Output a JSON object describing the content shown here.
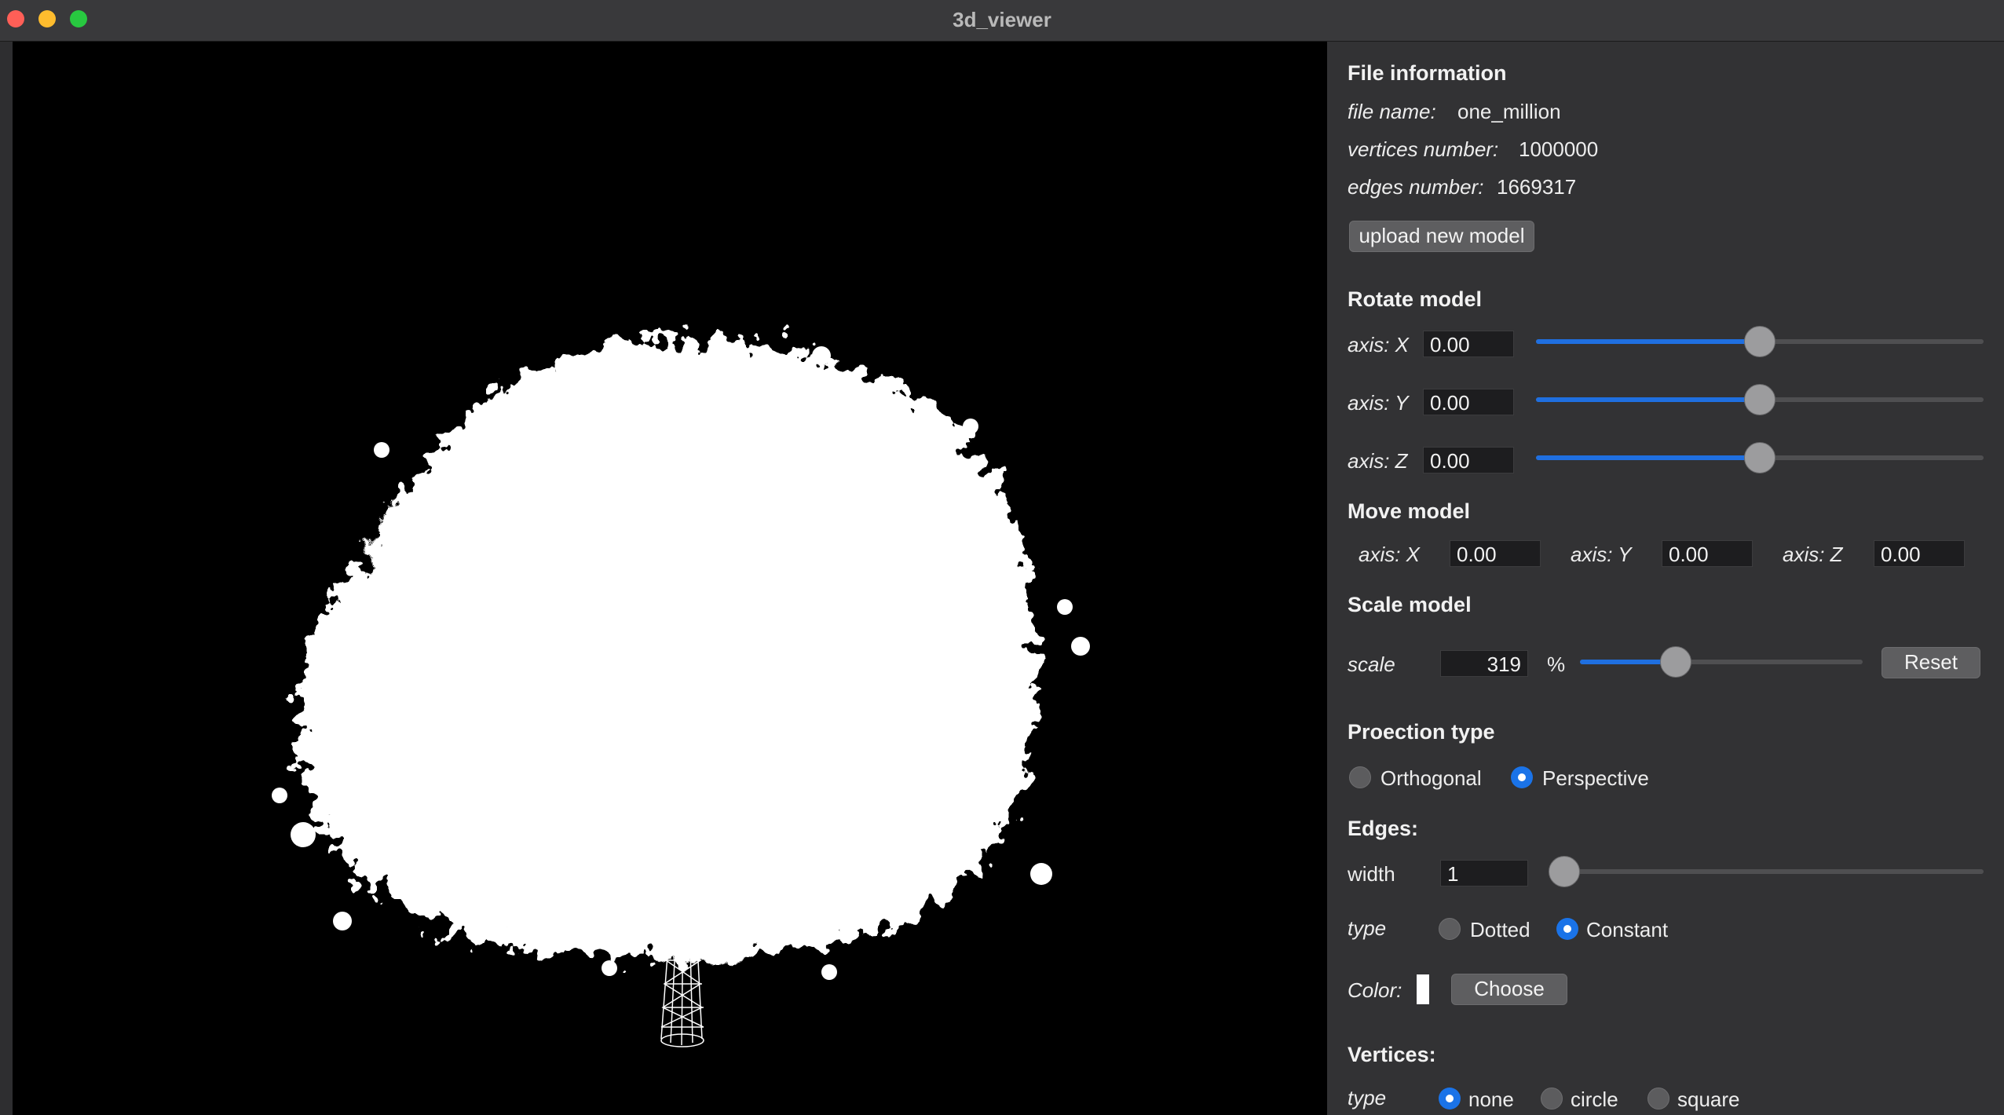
{
  "window": {
    "title": "3d_viewer"
  },
  "file_info": {
    "heading": "File information",
    "name_label": "file name:",
    "name_value": "one_million",
    "vertices_label": "vertices number:",
    "vertices_value": "1000000",
    "edges_label": "edges number:",
    "edges_value": "1669317",
    "upload_label": "upload new model"
  },
  "rotate": {
    "heading": "Rotate model",
    "x_label": "axis: X",
    "x_value": "0.00",
    "x_level": 0.5,
    "y_label": "axis: Y",
    "y_value": "0.00",
    "y_level": 0.5,
    "z_label": "axis: Z",
    "z_value": "0.00",
    "z_level": 0.5
  },
  "move": {
    "heading": "Move model",
    "x_label": "axis: X",
    "x_value": "0.00",
    "y_label": "axis: Y",
    "y_value": "0.00",
    "z_label": "axis: Z",
    "z_value": "0.00"
  },
  "scale": {
    "heading": "Scale model",
    "label": "scale",
    "value": "319",
    "unit": "%",
    "level": 0.34,
    "reset_label": "Reset"
  },
  "projection": {
    "heading": "Proection type",
    "option1": "Orthogonal",
    "option2": "Perspective",
    "selected": "Perspective"
  },
  "edges": {
    "heading": "Edges:",
    "width_label": "width",
    "width_value": "1",
    "width_level": 0.0,
    "type_label": "type",
    "type_option1": "Dotted",
    "type_option2": "Constant",
    "type_selected": "Constant",
    "color_label": "Color:",
    "color_value": "#ffffff",
    "choose_label": "Choose"
  },
  "vertices": {
    "heading": "Vertices:",
    "type_label": "type",
    "option1": "none",
    "option2": "circle",
    "option3": "square",
    "selected": "none"
  },
  "colors": {
    "accent": "#1f6fe0",
    "viewport_bg": "#000000",
    "model": "#ffffff"
  }
}
